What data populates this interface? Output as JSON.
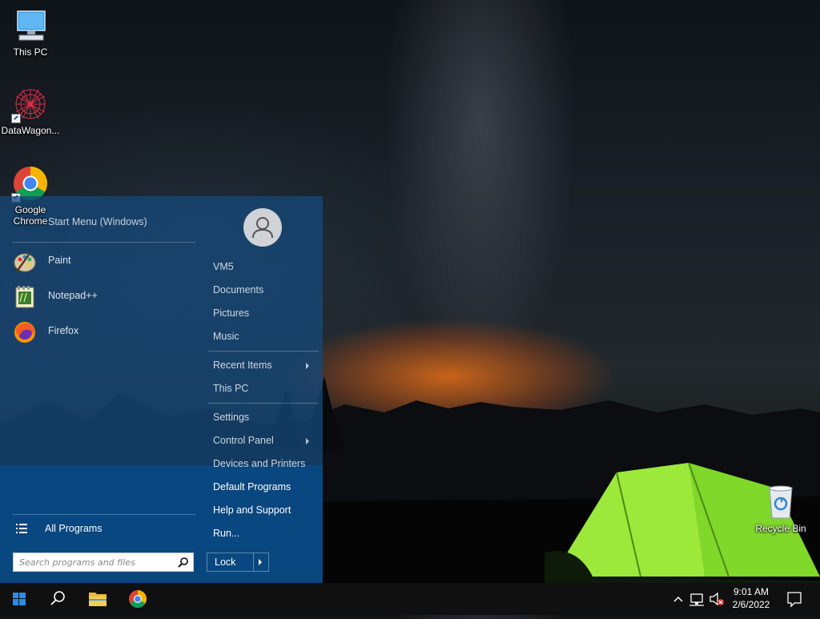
{
  "desktop": {
    "icons": [
      {
        "label": "This PC"
      },
      {
        "label": "DataWagon..."
      },
      {
        "label": "Google Chrome"
      },
      {
        "label": "Recycle Bin"
      }
    ]
  },
  "start_menu": {
    "title": "Start Menu (Windows)",
    "apps": [
      {
        "label": "Paint",
        "icon": "paint-icon"
      },
      {
        "label": "Notepad++",
        "icon": "notepadpp-icon"
      },
      {
        "label": "Firefox",
        "icon": "firefox-icon"
      }
    ],
    "all_programs_label": "All Programs",
    "search_placeholder": "Search programs and files",
    "user_links": [
      "VM5",
      "Documents",
      "Pictures",
      "Music"
    ],
    "recent_items_label": "Recent Items",
    "this_pc_label": "This PC",
    "settings_label": "Settings",
    "control_panel_label": "Control Panel",
    "devices_label": "Devices and Printers",
    "default_programs_label": "Default Programs",
    "help_label": "Help and Support",
    "run_label": "Run...",
    "lock_label": "Lock"
  },
  "taskbar": {
    "time": "9:01 AM",
    "date": "2/6/2022"
  },
  "colors": {
    "start_menu_bg": "#164878",
    "start_menu_bottom": "#08477f",
    "taskbar_bg": "#101010"
  }
}
